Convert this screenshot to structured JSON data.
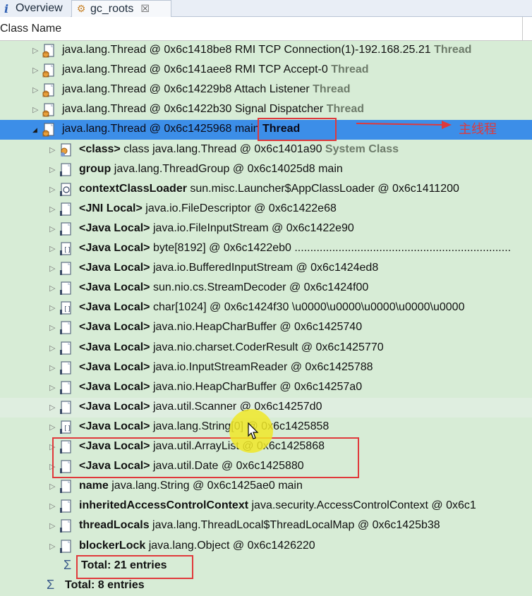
{
  "tabs": [
    {
      "label": "Overview",
      "icon": "info-icon"
    },
    {
      "label": "gc_roots",
      "icon": "gc-roots-icon",
      "close": "☒"
    }
  ],
  "columns": {
    "class_name": "Class Name"
  },
  "rows": [
    {
      "prefix": "",
      "text": "java.lang.Thread @ 0x6c1418be8  RMI TCP Connection(1)-192.168.25.21",
      "suffix": " Thread",
      "icon": "thread-object-icon"
    },
    {
      "prefix": "",
      "text": "java.lang.Thread @ 0x6c141aee8  RMI TCP Accept-0",
      "suffix": " Thread",
      "icon": "thread-object-icon"
    },
    {
      "prefix": "",
      "text": "java.lang.Thread @ 0x6c14229b8  Attach Listener",
      "suffix": " Thread",
      "icon": "thread-object-icon"
    },
    {
      "prefix": "",
      "text": "java.lang.Thread @ 0x6c1422b30  Signal Dispatcher",
      "suffix": " Thread",
      "icon": "thread-object-icon"
    },
    {
      "prefix": "",
      "text": "java.lang.Thread @ 0x6c1425968  main",
      "suffix": " Thread",
      "icon": "thread-object-icon"
    },
    {
      "prefix": "<class>",
      "text": " class java.lang.Thread @ 0x6c1401a90",
      "suffix": " System Class",
      "icon": "class-object-icon"
    },
    {
      "prefix": "group",
      "text": " java.lang.ThreadGroup @ 0x6c14025d8  main",
      "suffix": "",
      "icon": "object-icon"
    },
    {
      "prefix": "contextClassLoader",
      "text": " sun.misc.Launcher$AppClassLoader @ 0x6c1411200",
      "suffix": "",
      "icon": "classloader-icon"
    },
    {
      "prefix": "<JNI Local>",
      "text": " java.io.FileDescriptor @ 0x6c1422e68",
      "suffix": "",
      "icon": "object-icon"
    },
    {
      "prefix": "<Java Local>",
      "text": " java.io.FileInputStream @ 0x6c1422e90",
      "suffix": "",
      "icon": "object-icon"
    },
    {
      "prefix": "<Java Local>",
      "text": " byte[8192] @ 0x6c1422eb0  .....................................................................",
      "suffix": "",
      "icon": "array-icon"
    },
    {
      "prefix": "<Java Local>",
      "text": " java.io.BufferedInputStream @ 0x6c1424ed8",
      "suffix": "",
      "icon": "object-icon"
    },
    {
      "prefix": "<Java Local>",
      "text": " sun.nio.cs.StreamDecoder @ 0x6c1424f00",
      "suffix": "",
      "icon": "object-icon"
    },
    {
      "prefix": "<Java Local>",
      "text": " char[1024] @ 0x6c1424f30  \\u0000\\u0000\\u0000\\u0000\\u0000",
      "suffix": "",
      "icon": "array-icon"
    },
    {
      "prefix": "<Java Local>",
      "text": " java.nio.HeapCharBuffer @ 0x6c1425740",
      "suffix": "",
      "icon": "object-icon"
    },
    {
      "prefix": "<Java Local>",
      "text": " java.nio.charset.CoderResult @ 0x6c1425770",
      "suffix": "",
      "icon": "object-icon"
    },
    {
      "prefix": "<Java Local>",
      "text": " java.io.InputStreamReader @ 0x6c1425788",
      "suffix": "",
      "icon": "object-icon"
    },
    {
      "prefix": "<Java Local>",
      "text": " java.nio.HeapCharBuffer @ 0x6c14257a0",
      "suffix": "",
      "icon": "object-icon"
    },
    {
      "prefix": "<Java Local>",
      "text": " java.util.Scanner @ 0x6c14257d0",
      "suffix": "",
      "icon": "object-icon"
    },
    {
      "prefix": "<Java Local>",
      "text": " java.lang.String[0] @ 0x6c1425858",
      "suffix": "",
      "icon": "array-icon"
    },
    {
      "prefix": "<Java Local>",
      "text": " java.util.ArrayList @ 0x6c1425868",
      "suffix": "",
      "icon": "object-icon"
    },
    {
      "prefix": "<Java Local>",
      "text": " java.util.Date @ 0x6c1425880",
      "suffix": "",
      "icon": "object-icon"
    },
    {
      "prefix": "name",
      "text": " java.lang.String @ 0x6c1425ae0  main",
      "suffix": "",
      "icon": "object-icon"
    },
    {
      "prefix": "inheritedAccessControlContext",
      "text": " java.security.AccessControlContext @ 0x6c1",
      "suffix": "",
      "icon": "object-icon"
    },
    {
      "prefix": "threadLocals",
      "text": " java.lang.ThreadLocal$ThreadLocalMap @ 0x6c1425b38",
      "suffix": "",
      "icon": "object-icon"
    },
    {
      "prefix": "blockerLock",
      "text": " java.lang.Object @ 0x6c1426220",
      "suffix": "",
      "icon": "object-icon"
    }
  ],
  "totals": {
    "inner": {
      "symbol": "Σ",
      "label": "Total: 21 entries"
    },
    "outer": {
      "symbol": "Σ",
      "label": "Total: 8 entries"
    }
  },
  "annotation": {
    "label": "主线程",
    "color": "#e0393b"
  },
  "colors": {
    "background": "#d7ecd6",
    "selection": "#3c8ee8",
    "suffix": "#6d7b6a"
  }
}
